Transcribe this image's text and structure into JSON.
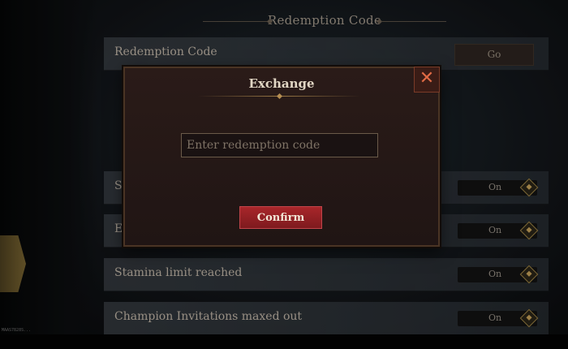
{
  "section": {
    "title": "Redemption Code"
  },
  "settings": {
    "redemption_row": {
      "label": "Redemption Code",
      "button": "Go"
    },
    "rows": [
      {
        "label": "S",
        "value": "On"
      },
      {
        "label": "E",
        "value": "On"
      },
      {
        "label": "Stamina limit reached",
        "value": "On"
      },
      {
        "label": "Champion Invitations maxed out",
        "value": "On"
      }
    ]
  },
  "modal": {
    "title": "Exchange",
    "close_icon": "close-icon",
    "input": {
      "placeholder": "Enter redemption code",
      "value": ""
    },
    "confirm_label": "Confirm"
  },
  "footer": {
    "tiny_text": "MAAS7828S..."
  },
  "colors": {
    "accent": "#a8262a",
    "gold": "#c9a45b"
  }
}
